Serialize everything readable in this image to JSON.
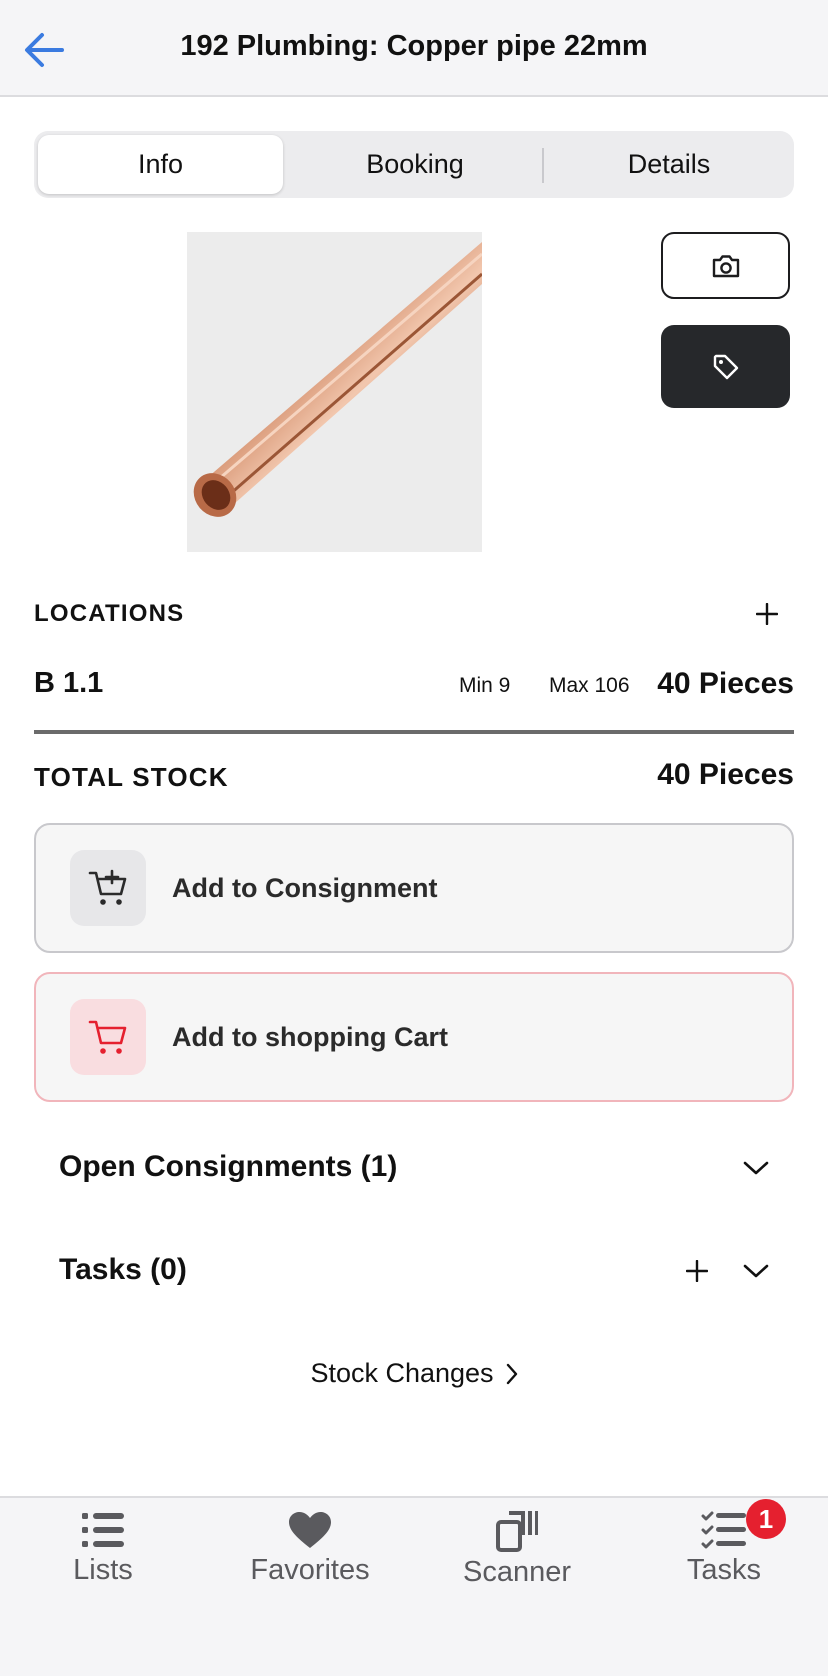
{
  "header": {
    "title": "192 Plumbing: Copper pipe 22mm"
  },
  "segments": [
    "Info",
    "Booking",
    "Details"
  ],
  "product_image": {
    "alt": "Copper pipe"
  },
  "locations": {
    "heading": "LOCATIONS",
    "rows": [
      {
        "name": "B 1.1",
        "min": "Min 9",
        "max": "Max 106",
        "qty": "40 Pieces"
      }
    ]
  },
  "total": {
    "label": "TOTAL STOCK",
    "qty": "40 Pieces"
  },
  "actions": {
    "consignment": "Add to Consignment",
    "cart": "Add to shopping Cart"
  },
  "sections": {
    "consignments": "Open Consignments (1)",
    "tasks": "Tasks (0)"
  },
  "stock_changes": "Stock Changes",
  "tabbar": {
    "lists": "Lists",
    "favorites": "Favorites",
    "scanner": "Scanner",
    "tasks": "Tasks",
    "tasks_badge": "1"
  },
  "colors": {
    "accent": "#3b7be0",
    "danger": "#e5202f",
    "dark": "#26282b"
  }
}
